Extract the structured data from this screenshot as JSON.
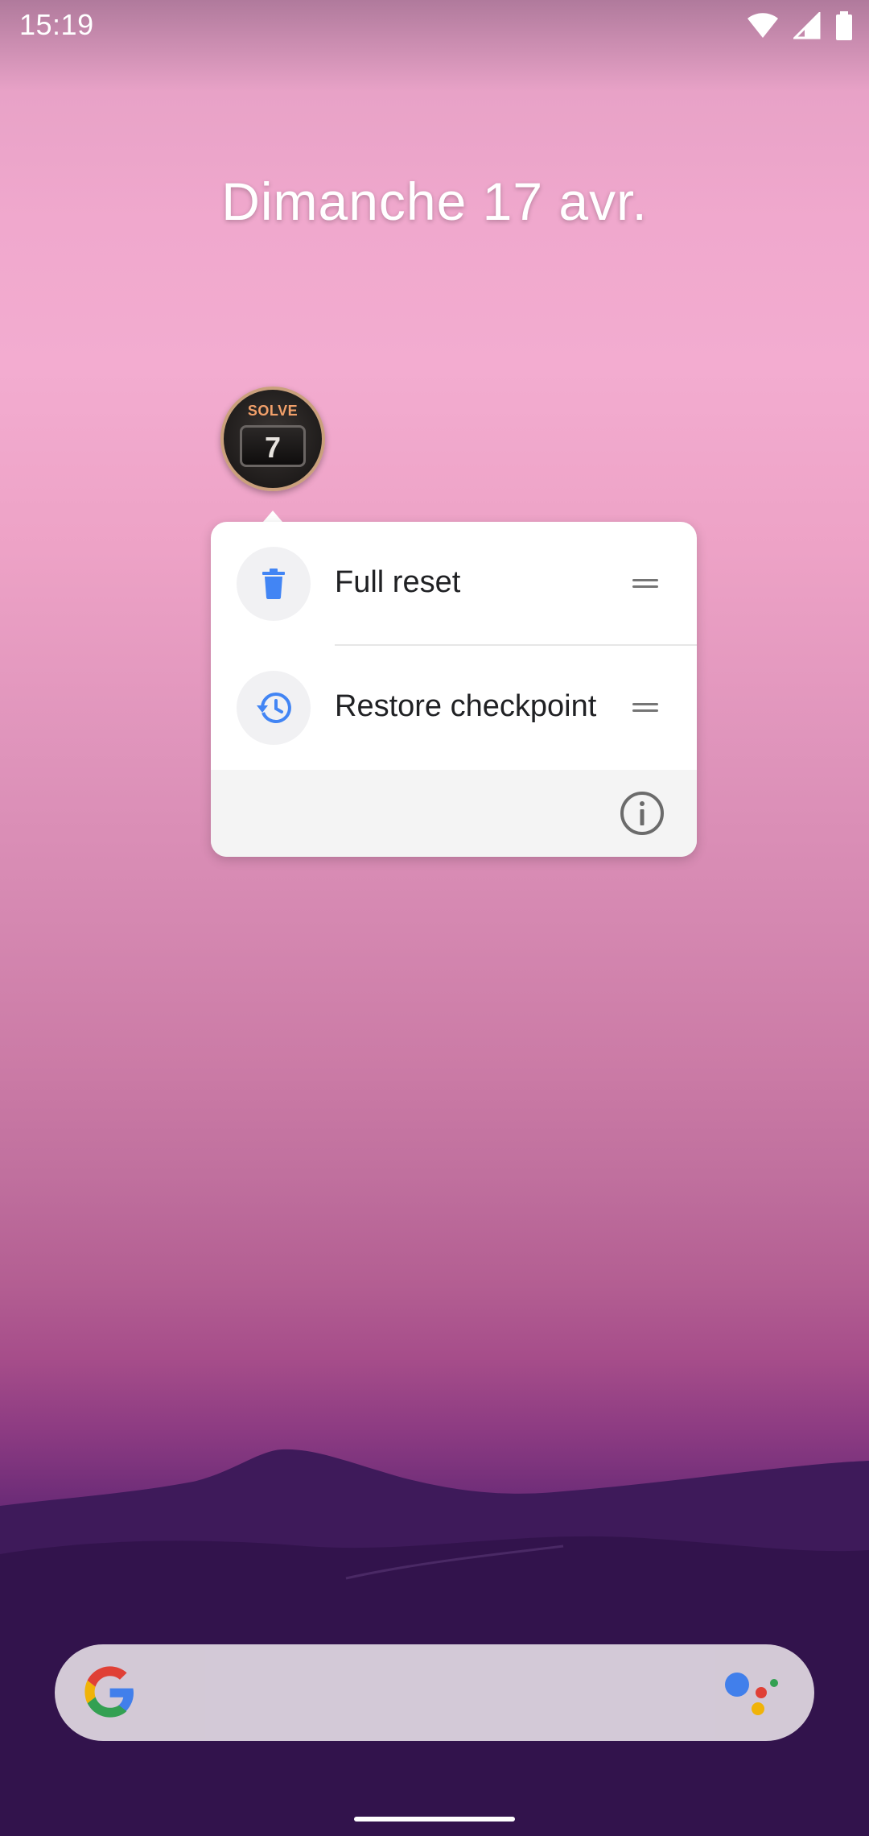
{
  "status_bar": {
    "time": "15:19"
  },
  "home": {
    "date": "Dimanche 17 avr."
  },
  "app_icon": {
    "badge_text": "SOLVE",
    "digit": "7"
  },
  "shortcut_menu": {
    "items": [
      {
        "label": "Full reset",
        "icon": "trash-icon"
      },
      {
        "label": "Restore checkpoint",
        "icon": "restore-history-icon"
      }
    ],
    "footer_icon": "info-icon"
  },
  "search": {
    "left_icon": "google-g-icon",
    "right_icon": "google-assistant-icon"
  },
  "colors": {
    "menu_icon_blue": "#4285f4",
    "google_blue": "#4285f4",
    "google_red": "#ea4335",
    "google_yellow": "#fbbc05",
    "google_green": "#34a853"
  }
}
